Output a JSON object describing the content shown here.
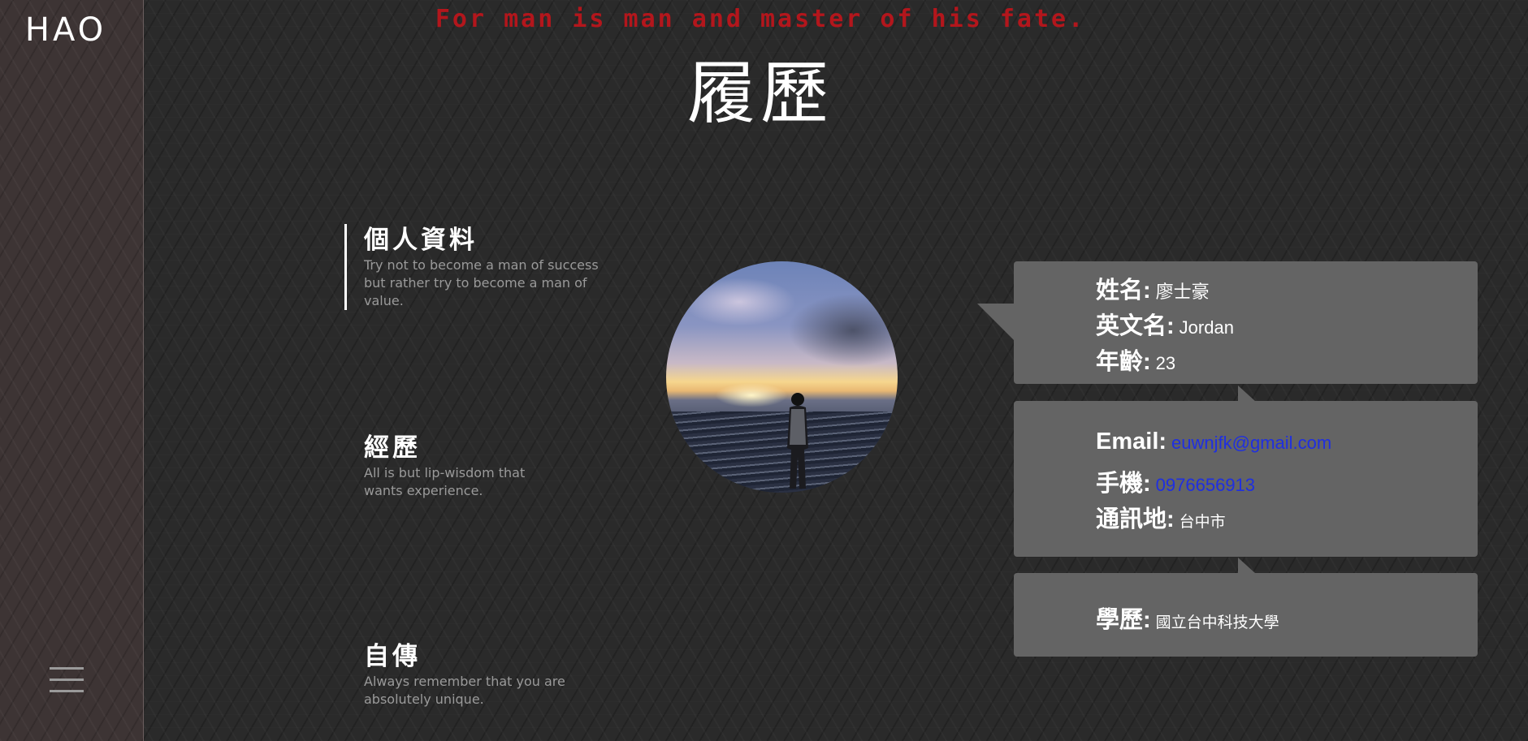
{
  "sidebar": {
    "logo": "HAO",
    "menu_icon": "hamburger-menu-icon"
  },
  "header": {
    "motto": "For man is man and master of his fate.",
    "title": "履歷"
  },
  "sections": [
    {
      "title": "個人資料",
      "desc": "Try not to become a man of success but rather try to become a man of value.",
      "active": true
    },
    {
      "title": "經歷",
      "desc": "All is but lip-wisdom that wants experience.",
      "active": false
    },
    {
      "title": "自傳",
      "desc": "Always remember that you are absolutely unique.",
      "active": false
    }
  ],
  "profile": {
    "name_label": "姓名:",
    "name_value": "廖士豪",
    "english_name_label": "英文名:",
    "english_name_value": "Jordan",
    "age_label": "年齡:",
    "age_value": "23"
  },
  "contact": {
    "email_label": "Email:",
    "email_value": "euwnjfk@gmail.com",
    "phone_label": "手機:",
    "phone_value": "0976656913",
    "address_label": "通訊地:",
    "address_value": "台中市"
  },
  "education": {
    "label": "學歷:",
    "value": "國立台中科技大學"
  },
  "colors": {
    "motto": "#b3161c",
    "link": "#1f2fe0",
    "card": "#646464",
    "sidebar": "#3d3434"
  }
}
